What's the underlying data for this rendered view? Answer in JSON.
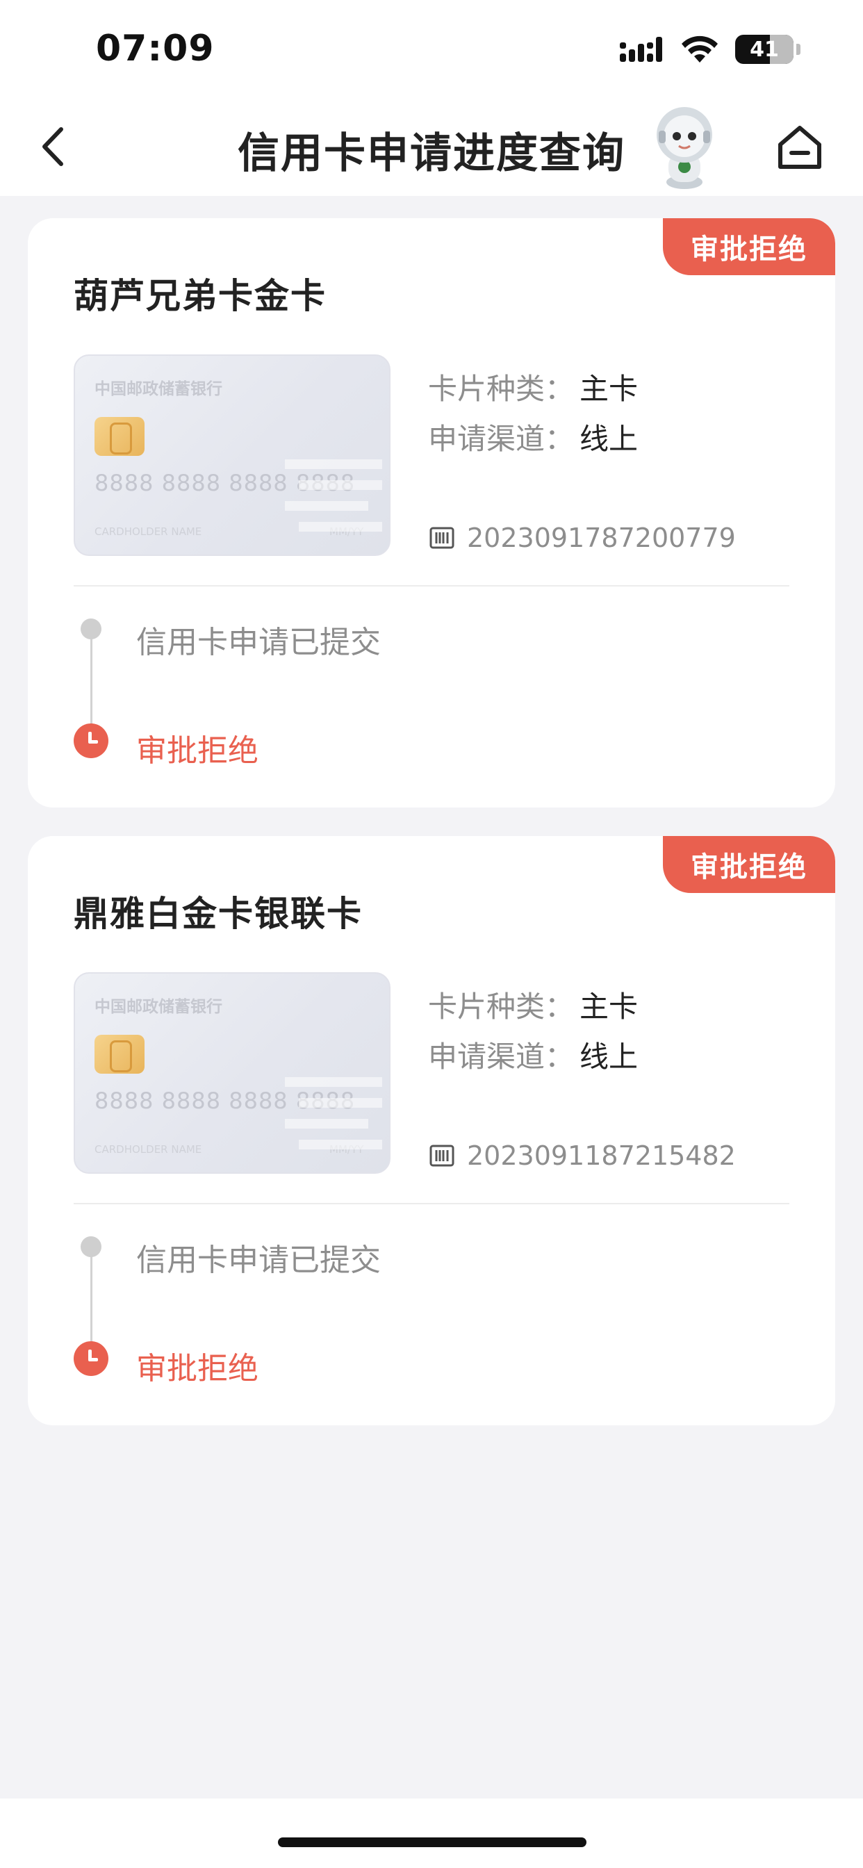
{
  "status_bar": {
    "time": "07:09",
    "battery": "41"
  },
  "nav": {
    "title": "信用卡申请进度查询"
  },
  "applications": [
    {
      "status_tag": "审批拒绝",
      "card_name": "葫芦兄弟卡金卡",
      "card_image": {
        "bank_name": "中国邮政储蓄银行",
        "number": "8888 8888 8888 8888",
        "holder": "CARDHOLDER NAME",
        "expiry": "MM/YY"
      },
      "card_type_label": "卡片种类：",
      "card_type": "主卡",
      "channel_label": "申请渠道：",
      "channel": "线上",
      "application_no": "2023091787200779",
      "steps": [
        "信用卡申请已提交",
        "审批拒绝"
      ]
    },
    {
      "status_tag": "审批拒绝",
      "card_name": "鼎雅白金卡银联卡",
      "card_image": {
        "bank_name": "中国邮政储蓄银行",
        "number": "8888 8888 8888 8888",
        "holder": "CARDHOLDER NAME",
        "expiry": "MM/YY"
      },
      "card_type_label": "卡片种类：",
      "card_type": "主卡",
      "channel_label": "申请渠道：",
      "channel": "线上",
      "application_no": "2023091187215482",
      "steps": [
        "信用卡申请已提交",
        "审批拒绝"
      ]
    }
  ],
  "colors": {
    "accent": "#e9604f",
    "background": "#f3f3f6",
    "muted_text": "#8d8d8d"
  },
  "icons": {
    "back": "chevron-left-icon",
    "home": "home-icon",
    "mascot": "astronaut-mascot-icon",
    "app_no": "barcode-icon"
  }
}
